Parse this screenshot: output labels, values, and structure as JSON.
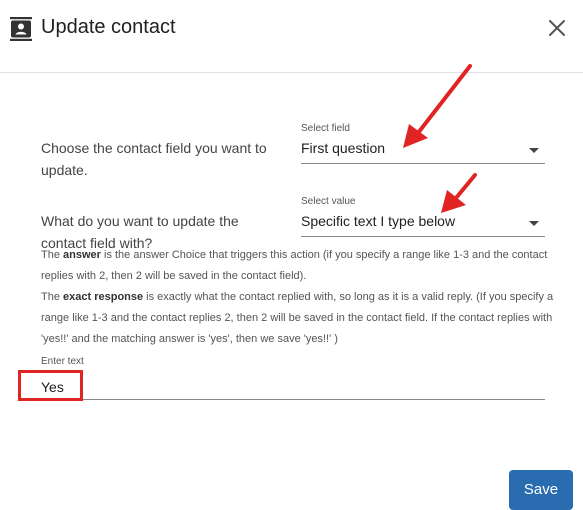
{
  "dialog": {
    "title": "Update contact",
    "header_icon": "contact-card-icon",
    "close_icon": "close-icon"
  },
  "question1": {
    "label": "Choose the contact field you want to update.",
    "caption": "Select field",
    "value": "First question"
  },
  "question2": {
    "label": "What do you want to update the contact field with?",
    "caption": "Select value",
    "value": "Specific text I type below"
  },
  "help": {
    "p1_bold": "answer",
    "p1_pre": "The ",
    "p1_rest": " is the answer Choice that triggers this action (if you specify a range like 1-3 and the contact replies with 2, then 2 will be saved in the contact field).",
    "p2_pre": "The ",
    "p2_bold": "exact response",
    "p2_rest": " is exactly what the contact replied with, so long as it is a valid reply. (If you specify a range like 1-3 and the contact replies 2, then 2 will be saved in the contact field. If the contact replies with 'yes!!' and the matching answer is 'yes', then we save 'yes!!' )"
  },
  "text_field": {
    "caption": "Enter text",
    "value": "Yes"
  },
  "footer": {
    "save_label": "Save"
  },
  "colors": {
    "annotation_red": "#e02424",
    "primary_button": "#2a6cb0"
  }
}
